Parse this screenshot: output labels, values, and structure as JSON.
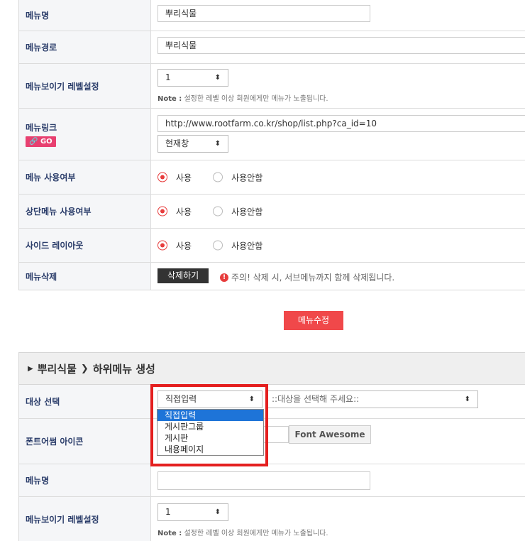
{
  "top_form": {
    "menu_name": {
      "label": "메뉴명",
      "value": "뿌리식물"
    },
    "menu_path": {
      "label": "메뉴경로",
      "value": "뿌리식물"
    },
    "level": {
      "label": "메뉴보이기 레벨설정",
      "value": "1",
      "note_prefix": "Note :",
      "note_text": "설정한 레벨 이상 회원에게만 메뉴가 노출됩니다."
    },
    "link": {
      "label": "메뉴링크",
      "badge": "GO",
      "url": "http://www.rootfarm.co.kr/shop/list.php?ca_id=10",
      "target": "현재창"
    },
    "use_menu": {
      "label": "메뉴 사용여부",
      "opt_on": "사용",
      "opt_off": "사용안함"
    },
    "top_menu": {
      "label": "상단메뉴 사용여부",
      "opt_on": "사용",
      "opt_off": "사용안함"
    },
    "side_layout": {
      "label": "사이드 레이아웃",
      "opt_on": "사용",
      "opt_off": "사용안함"
    },
    "delete": {
      "label": "메뉴삭제",
      "button": "삭제하기",
      "warn_icon": "!",
      "warning": "주의! 삭제 시, 서브메뉴까지 함께 삭제됩니다."
    }
  },
  "modify_button": "메뉴수정",
  "sub_section": {
    "title_parent": "뿌리식물",
    "title_child": "하위메뉴 생성",
    "target": {
      "label": "대상 선택",
      "value": "직접입력",
      "second_select": "::대상을 선택해 주세요::",
      "options": [
        "직접입력",
        "게시판그룹",
        "게시판",
        "내용페이지"
      ]
    },
    "icon": {
      "label": "폰트어썸 아이콘",
      "button": "Font Awesome"
    },
    "menu_name": {
      "label": "메뉴명",
      "value": ""
    },
    "level": {
      "label": "메뉴보이기 레벨설정",
      "value": "1",
      "note_prefix": "Note :",
      "note_text": "설정한 레벨 이상 회원에게만 메뉴가 노출됩니다."
    }
  },
  "icons": {
    "sort_arrow": "updown-arrow-icon",
    "link": "link-icon",
    "warning": "exclamation-icon",
    "caret": "caret-right-icon",
    "chevron": "chevron-right-icon"
  },
  "colors": {
    "accent_red": "#f0484a",
    "highlight_red": "#e41f1f",
    "label_navy": "#2c3e6b",
    "badge_pink": "#e84070",
    "select_blue": "#1e74d8"
  }
}
